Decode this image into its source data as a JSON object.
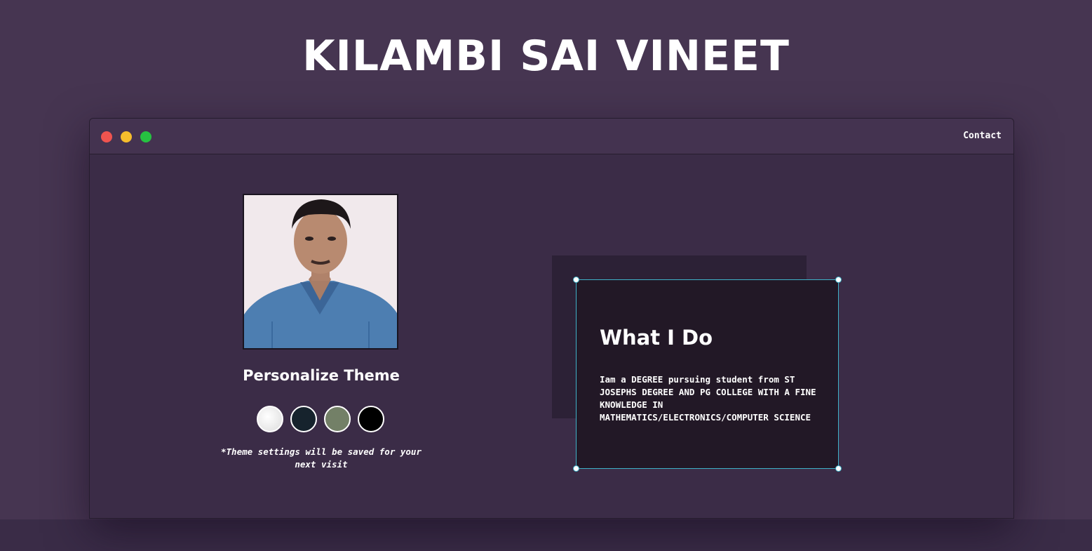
{
  "header": {
    "title": "KILAMBI SAI VINEET"
  },
  "window": {
    "controls": [
      "close",
      "minimize",
      "maximize"
    ],
    "nav": {
      "contact_label": "Contact"
    }
  },
  "profile": {
    "photo_icon": "profile-photo",
    "theme_heading": "Personalize Theme",
    "theme_swatches": [
      {
        "name": "light",
        "color": "#f2f2f2"
      },
      {
        "name": "navy",
        "color": "#16232d"
      },
      {
        "name": "olive",
        "color": "#738067"
      },
      {
        "name": "black",
        "color": "#000000"
      }
    ],
    "theme_note": "*Theme settings will be saved for your next visit"
  },
  "about": {
    "title": "What I Do",
    "body": "Iam a DEGREE pursuing student from ST JOSEPHS DEGREE AND PG COLLEGE WITH A FINE KNOWLEDGE IN MATHEMATICS/ELECTRONICS/COMPUTER SCIENCE"
  },
  "colors": {
    "page_background": "#463551",
    "window_background": "#3b2c47",
    "card_background": "#221826",
    "selection_accent": "#3fb2c8"
  }
}
